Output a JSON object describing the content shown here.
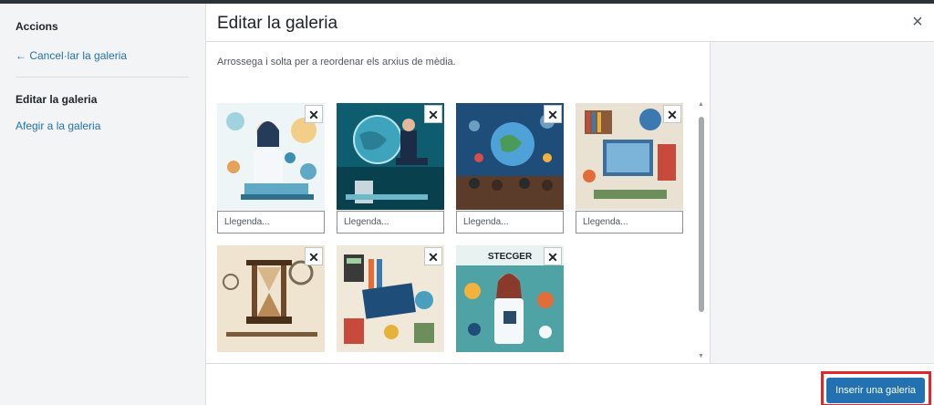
{
  "sidebar": {
    "heading": "Accions",
    "cancel": "← Cancel·lar la galeria",
    "edit": "Editar la galeria",
    "add": "Afegir a la galeria"
  },
  "header": {
    "title": "Editar la galeria",
    "close": "×"
  },
  "content": {
    "instructions": "Arrossega i solta per a reordenar els arxius de mèdia."
  },
  "gallery": {
    "caption_placeholder": "Llegenda...",
    "remove_glyph": "✕",
    "items": [
      {
        "image": "woman-scientist-illustration"
      },
      {
        "image": "globe-microscope-illustration"
      },
      {
        "image": "earth-classroom-illustration"
      },
      {
        "image": "books-globe-desk-illustration"
      },
      {
        "image": "hourglass-instruments-illustration"
      },
      {
        "image": "books-stationery-illustration"
      },
      {
        "image": "woman-steacer-illustration",
        "image_text": "STECGER"
      }
    ]
  },
  "footer": {
    "insert_label": "Inserir una galeria"
  },
  "colors": {
    "accent": "#2271b1",
    "highlight": "#e2272b"
  }
}
